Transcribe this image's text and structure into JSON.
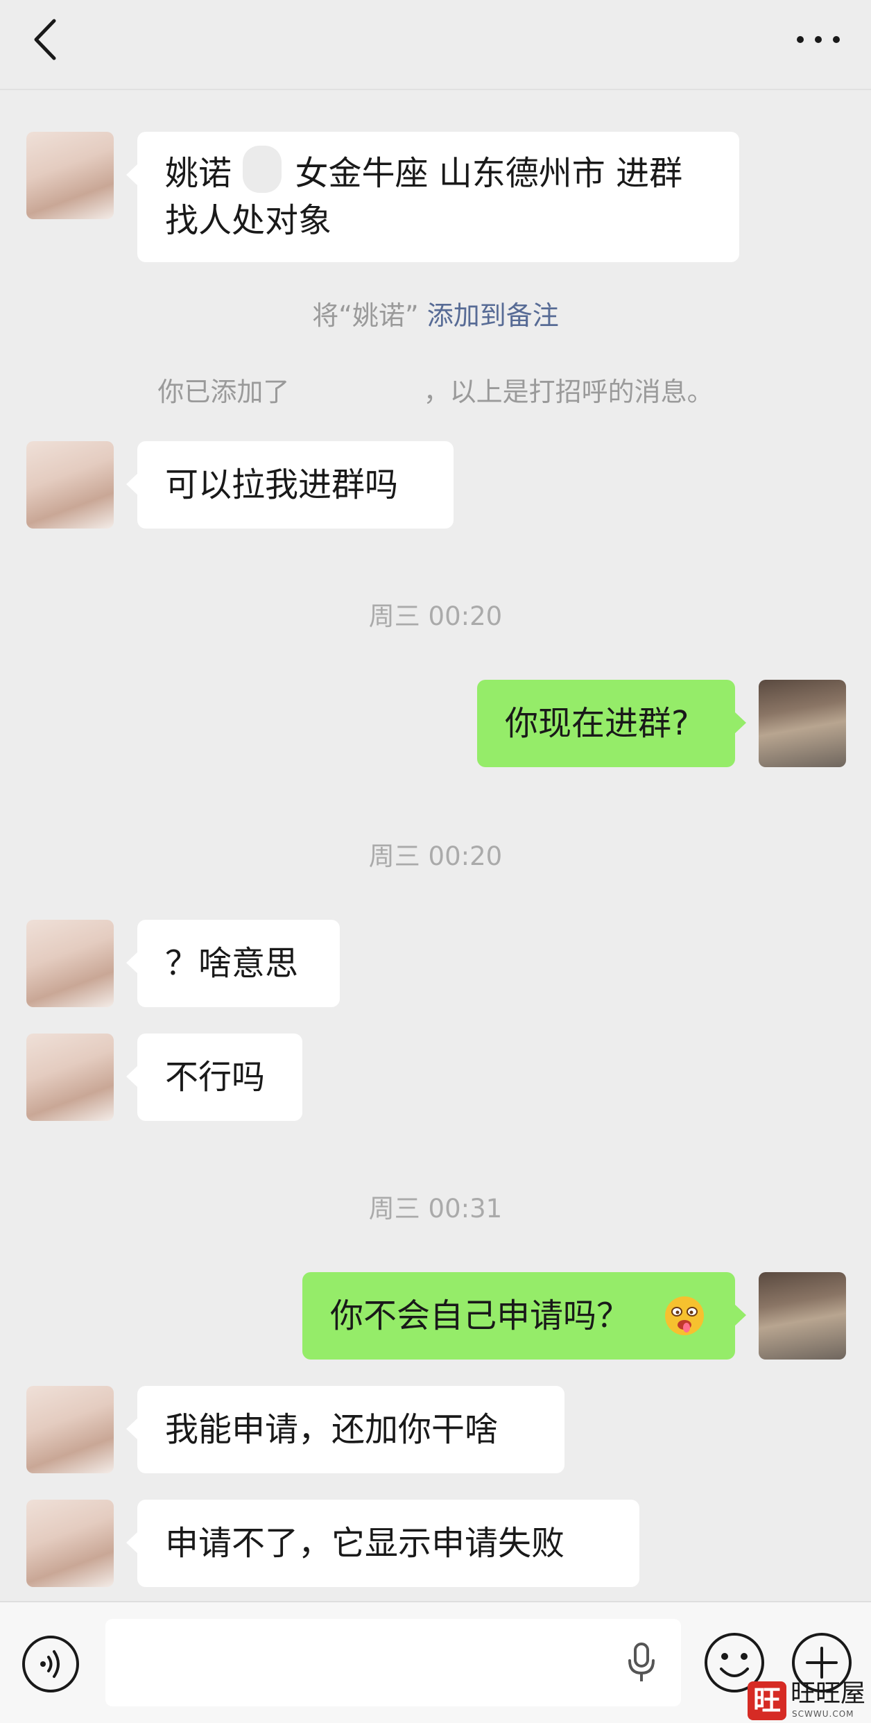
{
  "header": {
    "back_icon": "chevron-left-icon",
    "more_icon": "more-dots-icon"
  },
  "messages": {
    "m1": {
      "text": "姚诺      女金牛座 山东德州市 进群找人处对象",
      "side": "incoming"
    },
    "sys1": {
      "prefix": "将“姚诺” ",
      "link": "添加到备注"
    },
    "sys2": {
      "text": "你已添加了                ，以上是打招呼的消息。"
    },
    "m2": {
      "text": "可以拉我进群吗",
      "side": "incoming"
    },
    "t1": {
      "text": "周三 00:20"
    },
    "m3": {
      "text": "你现在进群?",
      "side": "outgoing"
    },
    "t2": {
      "text": "周三 00:20"
    },
    "m4": {
      "text": "？啥意思",
      "side": "incoming"
    },
    "m5": {
      "text": "不行吗",
      "side": "incoming"
    },
    "t3": {
      "text": "周三 00:31"
    },
    "m6": {
      "text": "你不会自己申请吗？",
      "side": "outgoing",
      "emoji": "drooling-face-emoji"
    },
    "m7": {
      "text": "我能申请，还加你干啥",
      "side": "incoming"
    },
    "m8": {
      "text": "申请不了，它显示申请失败",
      "side": "incoming"
    }
  },
  "input_bar": {
    "voice_icon": "voice-icon",
    "mic_icon": "microphone-icon",
    "emoji_icon": "emoji-icon",
    "plus_icon": "plus-icon",
    "input_value": ""
  },
  "watermark": {
    "logo_char": "旺",
    "text": "旺旺屋",
    "sub": "SCWWU.COM"
  },
  "colors": {
    "background": "#ededed",
    "incoming_bubble": "#ffffff",
    "outgoing_bubble": "#95ec69",
    "link": "#576b95",
    "system_text": "#9a9a9a",
    "watermark_red": "#d62b24"
  }
}
